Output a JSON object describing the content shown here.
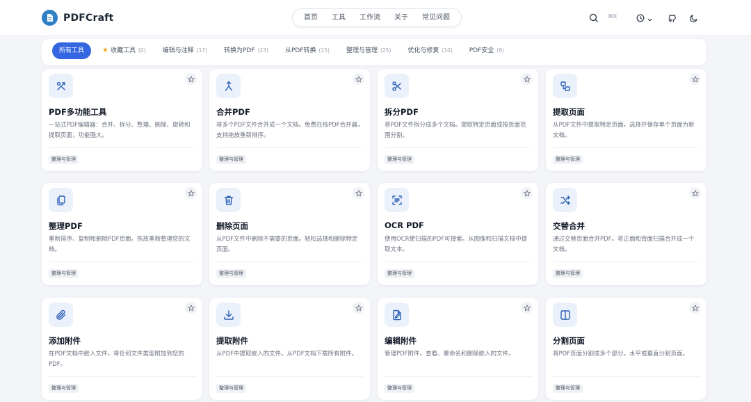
{
  "app": {
    "name": "PDFCraft",
    "shortcut": "⌘K"
  },
  "nav": [
    "首页",
    "工具",
    "工作流",
    "关于",
    "常见问题"
  ],
  "filters": [
    {
      "label": "所有工具",
      "count": "",
      "active": true
    },
    {
      "label": "收藏工具",
      "count": "(0)",
      "star": true
    },
    {
      "label": "编辑与注释",
      "count": "(17)"
    },
    {
      "label": "转换为PDF",
      "count": "(23)"
    },
    {
      "label": "从PDF转换",
      "count": "(15)"
    },
    {
      "label": "整理与管理",
      "count": "(25)"
    },
    {
      "label": "优化与修复",
      "count": "(10)"
    },
    {
      "label": "PDF安全",
      "count": "(9)"
    }
  ],
  "colors": {
    "accent": "#3366e0",
    "icon": "#2b5fb8",
    "icon_bg": "#eaf1fb",
    "star": "#f5a623"
  },
  "tools": [
    {
      "title": "PDF多功能工具",
      "desc": "一站式PDF编辑器：合并、拆分、整理、删除、旋转和提取页面，功能强大。",
      "tag": "整理与管理",
      "icon": "tools-icon"
    },
    {
      "title": "合并PDF",
      "desc": "将多个PDF文件合并成一个文档。免费在线PDF合并器，支持拖放重新排序。",
      "tag": "整理与管理",
      "icon": "merge-icon"
    },
    {
      "title": "拆分PDF",
      "desc": "将PDF文件拆分成多个文档。提取特定页面或按页面范围分割。",
      "tag": "整理与管理",
      "icon": "scissors-icon"
    },
    {
      "title": "提取页面",
      "desc": "从PDF文件中提取特定页面。选择并保存单个页面为新文档。",
      "tag": "整理与管理",
      "icon": "extract-pages-icon"
    },
    {
      "title": "整理PDF",
      "desc": "重新排序、复制和删除PDF页面。拖放重新整理您的文档。",
      "tag": "整理与管理",
      "icon": "copy-icon"
    },
    {
      "title": "删除页面",
      "desc": "从PDF文件中删除不需要的页面。轻松选择和删除特定页面。",
      "tag": "整理与管理",
      "icon": "trash-icon"
    },
    {
      "title": "OCR PDF",
      "desc": "使用OCR使扫描的PDF可搜索。从图像和扫描文档中提取文本。",
      "tag": "整理与管理",
      "icon": "scan-text-icon"
    },
    {
      "title": "交替合并",
      "desc": "通过交替页面合并PDF。将正面和背面扫描合并成一个文档。",
      "tag": "整理与管理",
      "icon": "shuffle-icon"
    },
    {
      "title": "添加附件",
      "desc": "在PDF文档中嵌入文件。将任何文件类型附加到您的PDF。",
      "tag": "整理与管理",
      "icon": "paperclip-icon"
    },
    {
      "title": "提取附件",
      "desc": "从PDF中提取嵌入的文件。从PDF文档下载所有附件。",
      "tag": "整理与管理",
      "icon": "download-icon"
    },
    {
      "title": "编辑附件",
      "desc": "管理PDF附件。查看、重命名和删除嵌入的文件。",
      "tag": "整理与管理",
      "icon": "file-edit-icon"
    },
    {
      "title": "分割页面",
      "desc": "将PDF页面分割成多个部分。水平或垂直分割页面。",
      "tag": "整理与管理",
      "icon": "columns-icon"
    }
  ]
}
